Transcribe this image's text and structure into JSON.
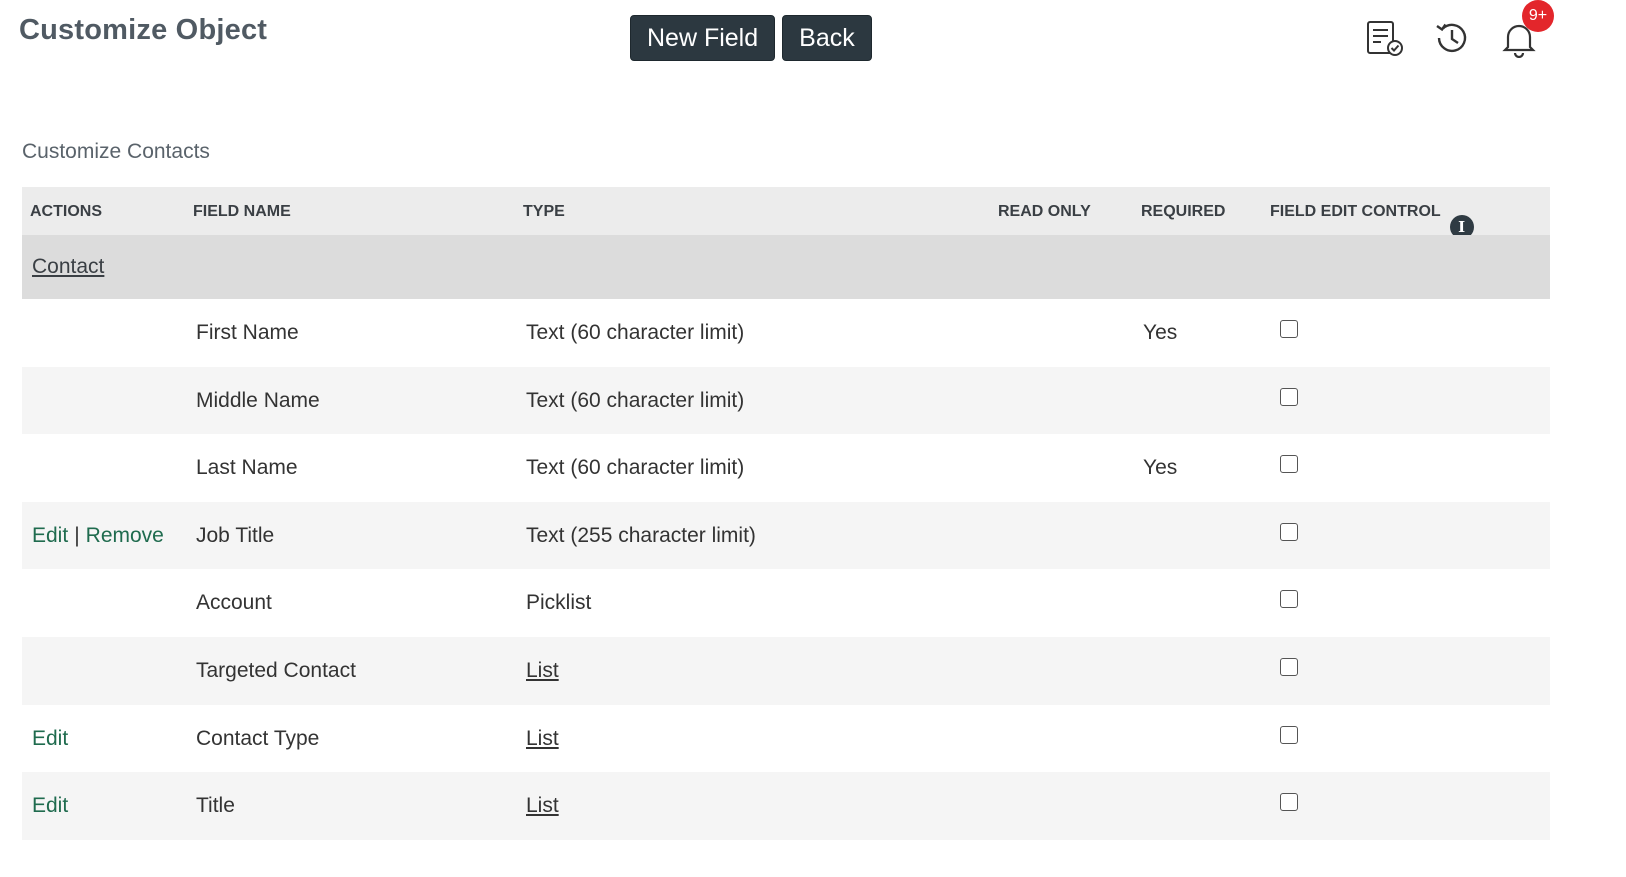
{
  "header": {
    "title": "Customize Object",
    "new_field_label": "New Field",
    "back_label": "Back",
    "notification_badge": "9+"
  },
  "section": {
    "title": "Customize Contacts"
  },
  "table": {
    "columns": {
      "actions": "ACTIONS",
      "field_name": "FIELD NAME",
      "type": "TYPE",
      "read_only": "READ ONLY",
      "required": "REQUIRED",
      "field_edit_control": "FIELD EDIT CONTROL"
    },
    "group": "Contact",
    "rows": [
      {
        "edit": "",
        "remove": "",
        "sep": "",
        "name": "First Name",
        "type": "Text (60 character limit)",
        "type_link": false,
        "read_only": "",
        "required": "Yes",
        "checked": false
      },
      {
        "edit": "",
        "remove": "",
        "sep": "",
        "name": "Middle Name",
        "type": "Text (60 character limit)",
        "type_link": false,
        "read_only": "",
        "required": "",
        "checked": false
      },
      {
        "edit": "",
        "remove": "",
        "sep": "",
        "name": "Last Name",
        "type": "Text (60 character limit)",
        "type_link": false,
        "read_only": "",
        "required": "Yes",
        "checked": false
      },
      {
        "edit": "Edit",
        "remove": "Remove",
        "sep": "|",
        "name": "Job Title",
        "type": "Text (255 character limit)",
        "type_link": false,
        "read_only": "",
        "required": "",
        "checked": false
      },
      {
        "edit": "",
        "remove": "",
        "sep": "",
        "name": "Account",
        "type": "Picklist",
        "type_link": false,
        "read_only": "",
        "required": "",
        "checked": false
      },
      {
        "edit": "",
        "remove": "",
        "sep": "",
        "name": "Targeted Contact",
        "type": "List",
        "type_link": true,
        "read_only": "",
        "required": "",
        "checked": false
      },
      {
        "edit": "Edit",
        "remove": "",
        "sep": "",
        "name": "Contact Type",
        "type": "List",
        "type_link": true,
        "read_only": "",
        "required": "",
        "checked": false
      },
      {
        "edit": "Edit",
        "remove": "",
        "sep": "",
        "name": "Title",
        "type": "List",
        "type_link": true,
        "read_only": "",
        "required": "",
        "checked": false
      }
    ]
  }
}
